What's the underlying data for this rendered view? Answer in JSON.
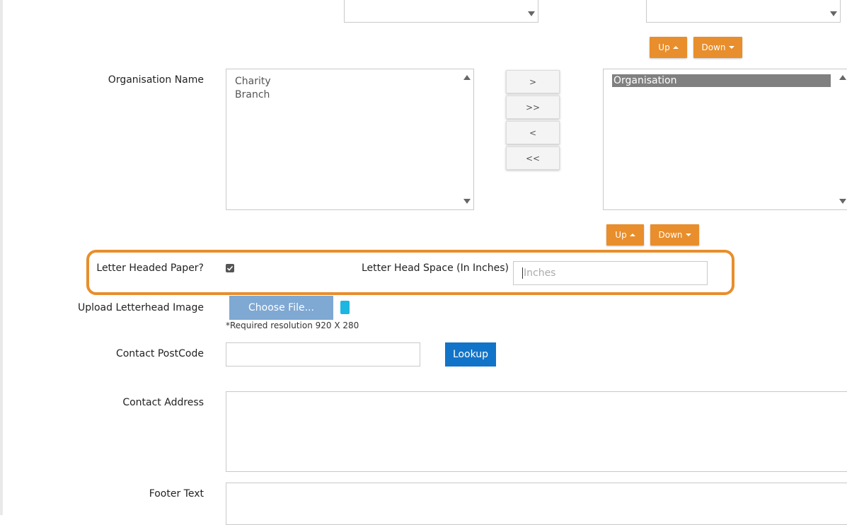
{
  "top_lists": {
    "up_label": "Up",
    "down_label": "Down"
  },
  "organisation": {
    "label": "Organisation Name",
    "available_items": [
      "Charity",
      "Branch"
    ],
    "selected_items": [
      "Organisation"
    ],
    "move_buttons": {
      "add": ">",
      "add_all": ">>",
      "remove": "<",
      "remove_all": "<<"
    },
    "up_label": "Up",
    "down_label": "Down"
  },
  "letterhead": {
    "paper_label": "Letter Headed Paper?",
    "paper_checked": true,
    "space_label": "Letter Head Space (In Inches)",
    "space_placeholder": "Inches",
    "highlight_color": "#e88e2c"
  },
  "upload": {
    "label": "Upload Letterhead Image",
    "button_label": "Choose File...",
    "hint": "*Required resolution 920 X 280"
  },
  "contact": {
    "postcode_label": "Contact PostCode",
    "lookup_label": "Lookup",
    "address_label": "Contact Address"
  },
  "footer": {
    "label": "Footer Text"
  },
  "colors": {
    "accent_orange": "#e88e2c",
    "lookup_blue": "#1274c8",
    "choose_file_blue": "#7fa8d3",
    "selected_grey": "#808080"
  }
}
